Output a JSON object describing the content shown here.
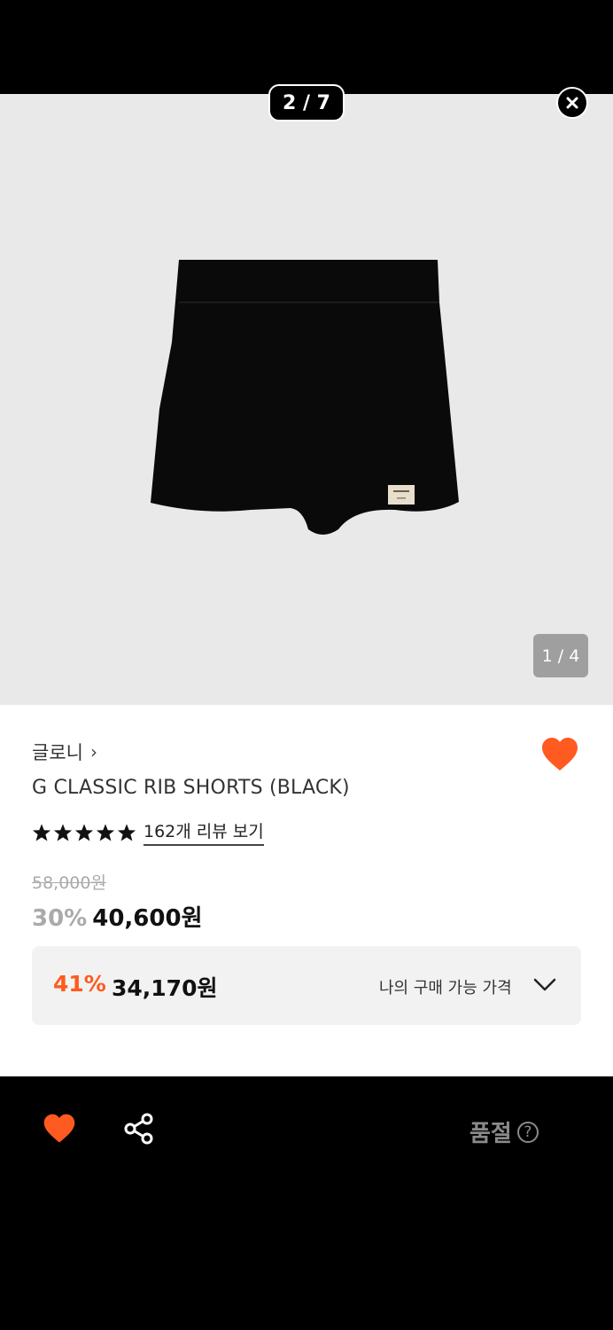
{
  "viewer": {
    "counter": "2 / 7",
    "image_indicator": "1 / 4"
  },
  "product": {
    "brand": "글로니",
    "title": "G CLASSIC RIB SHORTS (BLACK)",
    "rating_stars": 5,
    "review_link": "162개 리뷰 보기",
    "original_price": "58,000원",
    "discount_percent": "30%",
    "sale_price": "40,600원",
    "wishlisted": true
  },
  "my_price": {
    "percent": "41%",
    "price": "34,170원",
    "label": "나의 구매 가능 가격"
  },
  "bottom_bar": {
    "status": "품절",
    "help": "?"
  },
  "colors": {
    "accent": "#ff5a1f",
    "image_bg": "#e9e9e9",
    "muted": "#8a8a8a"
  },
  "icons": [
    "close-icon",
    "heart-icon",
    "share-icon",
    "chevron-down-icon",
    "help-icon",
    "star-icon"
  ]
}
